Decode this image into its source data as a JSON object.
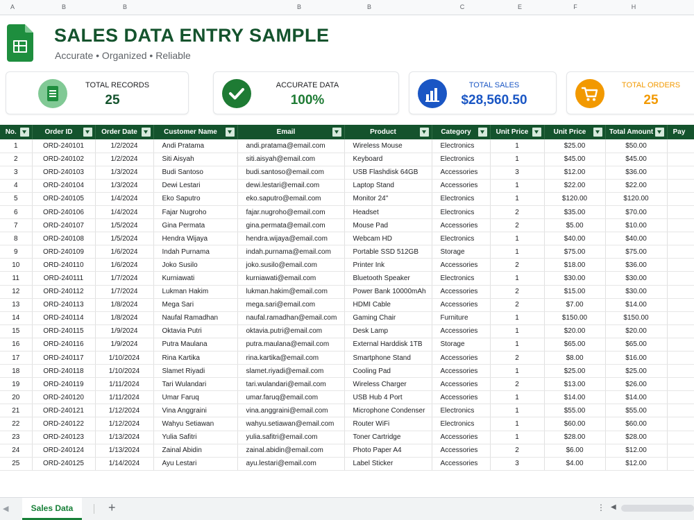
{
  "column_letters": [
    "A",
    "B",
    "B",
    "B",
    "B",
    "C",
    "E",
    "F",
    "H"
  ],
  "header": {
    "title": "SALES DATA ENTRY SAMPLE",
    "subtitle": "Accurate • Organized • Reliable"
  },
  "cards": [
    {
      "label": "TOTAL RECORDS",
      "value": "25",
      "icon": "sheet-icon",
      "color": "#1e8e3e"
    },
    {
      "label": "ACCURATE DATA",
      "value": "100%",
      "icon": "check-icon",
      "color": "#1e7b34"
    },
    {
      "label": "TOTAL SALES",
      "value": "$28,560.50",
      "icon": "bar-chart-icon",
      "color": "#1a56c4"
    },
    {
      "label": "TOTAL ORDERS",
      "value": "25",
      "icon": "cart-icon",
      "color": "#f29900"
    }
  ],
  "table": {
    "headers": [
      "No.",
      "Order ID",
      "Order Date",
      "Customer Name",
      "Email",
      "Product",
      "Category",
      "Unit Price",
      "Unit Price",
      "Total Amount",
      "Pay"
    ],
    "rows": [
      [
        "1",
        "ORD-240101",
        "1/2/2024",
        "Andi Pratama",
        "andi.pratama@email.com",
        "Wireless Mouse",
        "Electronics",
        "1",
        "$25.00",
        "$50.00"
      ],
      [
        "2",
        "ORD-240102",
        "1/2/2024",
        "Siti Aisyah",
        "siti.aisyah@email.com",
        "Keyboard",
        "Electronics",
        "1",
        "$45.00",
        "$45.00"
      ],
      [
        "3",
        "ORD-240103",
        "1/3/2024",
        "Budi Santoso",
        "budi.santoso@email.com",
        "USB Flashdisk 64GB",
        "Accessories",
        "3",
        "$12.00",
        "$36.00"
      ],
      [
        "4",
        "ORD-240104",
        "1/3/2024",
        "Dewi Lestari",
        "dewi.lestari@email.com",
        "Laptop Stand",
        "Accessories",
        "1",
        "$22.00",
        "$22.00"
      ],
      [
        "5",
        "ORD-240105",
        "1/4/2024",
        "Eko Saputro",
        "eko.saputro@email.com",
        "Monitor 24\"",
        "Electronics",
        "1",
        "$120.00",
        "$120.00"
      ],
      [
        "6",
        "ORD-240106",
        "1/4/2024",
        "Fajar Nugroho",
        "fajar.nugroho@email.com",
        "Headset",
        "Electronics",
        "2",
        "$35.00",
        "$70.00"
      ],
      [
        "7",
        "ORD-240107",
        "1/5/2024",
        "Gina Permata",
        "gina.permata@email.com",
        "Mouse Pad",
        "Accessories",
        "2",
        "$5.00",
        "$10.00"
      ],
      [
        "8",
        "ORD-240108",
        "1/5/2024",
        "Hendra Wijaya",
        "hendra.wijaya@email.com",
        "Webcam HD",
        "Electronics",
        "1",
        "$40.00",
        "$40.00"
      ],
      [
        "9",
        "ORD-240109",
        "1/6/2024",
        "Indah Purnama",
        "indah.purnama@email.com",
        "Portable SSD 512GB",
        "Storage",
        "1",
        "$75.00",
        "$75.00"
      ],
      [
        "10",
        "ORD-240110",
        "1/6/2024",
        "Joko Susilo",
        "joko.susilo@email.com",
        "Printer Ink",
        "Accessories",
        "2",
        "$18.00",
        "$36.00"
      ],
      [
        "11",
        "ORD-240111",
        "1/7/2024",
        "Kurniawati",
        "kurniawati@email.com",
        "Bluetooth Speaker",
        "Electronics",
        "1",
        "$30.00",
        "$30.00"
      ],
      [
        "12",
        "ORD-240112",
        "1/7/2024",
        "Lukman Hakim",
        "lukman.hakim@email.com",
        "Power Bank 10000mAh",
        "Accessories",
        "2",
        "$15.00",
        "$30.00"
      ],
      [
        "13",
        "ORD-240113",
        "1/8/2024",
        "Mega Sari",
        "mega.sari@email.com",
        "HDMI Cable",
        "Accessories",
        "2",
        "$7.00",
        "$14.00"
      ],
      [
        "14",
        "ORD-240114",
        "1/8/2024",
        "Naufal Ramadhan",
        "naufal.ramadhan@email.com",
        "Gaming Chair",
        "Furniture",
        "1",
        "$150.00",
        "$150.00"
      ],
      [
        "15",
        "ORD-240115",
        "1/9/2024",
        "Oktavia Putri",
        "oktavia.putri@email.com",
        "Desk Lamp",
        "Accessories",
        "1",
        "$20.00",
        "$20.00"
      ],
      [
        "16",
        "ORD-240116",
        "1/9/2024",
        "Putra Maulana",
        "putra.maulana@email.com",
        "External Harddisk 1TB",
        "Storage",
        "1",
        "$65.00",
        "$65.00"
      ],
      [
        "17",
        "ORD-240117",
        "1/10/2024",
        "Rina Kartika",
        "rina.kartika@email.com",
        "Smartphone Stand",
        "Accessories",
        "2",
        "$8.00",
        "$16.00"
      ],
      [
        "18",
        "ORD-240118",
        "1/10/2024",
        "Slamet Riyadi",
        "slamet.riyadi@email.com",
        "Cooling Pad",
        "Accessories",
        "1",
        "$25.00",
        "$25.00"
      ],
      [
        "19",
        "ORD-240119",
        "1/11/2024",
        "Tari Wulandari",
        "tari.wulandari@email.com",
        "Wireless Charger",
        "Accessories",
        "2",
        "$13.00",
        "$26.00"
      ],
      [
        "20",
        "ORD-240120",
        "1/11/2024",
        "Umar Faruq",
        "umar.faruq@email.com",
        "USB Hub 4 Port",
        "Accessories",
        "1",
        "$14.00",
        "$14.00"
      ],
      [
        "21",
        "ORD-240121",
        "1/12/2024",
        "Vina Anggraini",
        "vina.anggraini@email.com",
        "Microphone Condenser",
        "Electronics",
        "1",
        "$55.00",
        "$55.00"
      ],
      [
        "22",
        "ORD-240122",
        "1/12/2024",
        "Wahyu Setiawan",
        "wahyu.setiawan@email.com",
        "Router WiFi",
        "Electronics",
        "1",
        "$60.00",
        "$60.00"
      ],
      [
        "23",
        "ORD-240123",
        "1/13/2024",
        "Yulia Safitri",
        "yulia.safitri@email.com",
        "Toner Cartridge",
        "Accessories",
        "1",
        "$28.00",
        "$28.00"
      ],
      [
        "24",
        "ORD-240124",
        "1/13/2024",
        "Zainal Abidin",
        "zainal.abidin@email.com",
        "Photo Paper A4",
        "Accessories",
        "2",
        "$6.00",
        "$12.00"
      ],
      [
        "25",
        "ORD-240125",
        "1/14/2024",
        "Ayu Lestari",
        "ayu.lestari@email.com",
        "Label Sticker",
        "Accessories",
        "3",
        "$4.00",
        "$12.00"
      ]
    ]
  },
  "footer": {
    "sheet_tab": "Sales Data",
    "add_sheet": "+",
    "more": "⋮",
    "scroll_left": "◀",
    "nav_left": "◀"
  }
}
